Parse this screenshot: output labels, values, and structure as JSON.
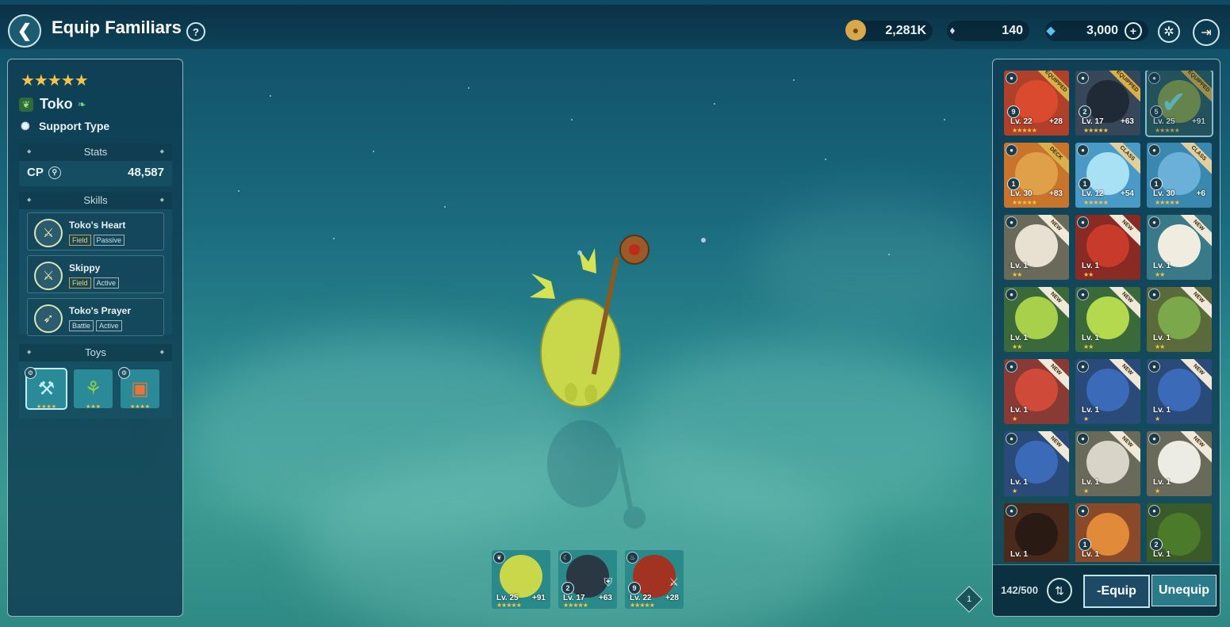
{
  "header": {
    "title": "Equip Familiars",
    "help": "?",
    "currencies": [
      {
        "name": "gold",
        "value": "2,281K",
        "icon": "gold-coin-icon",
        "color": "#d9a84a"
      },
      {
        "name": "crystal",
        "value": "140",
        "icon": "crystal-icon",
        "color": "#b8c8e8"
      },
      {
        "name": "gem",
        "value": "3,000",
        "icon": "diamond-icon",
        "color": "#5fc0f0"
      }
    ]
  },
  "familiar": {
    "stars": "★★★★★",
    "name": "Toko",
    "type": "Support Type",
    "stats_title": "Stats",
    "cp_label": "CP",
    "cp_value": "48,587",
    "skills_title": "Skills",
    "skills": [
      {
        "name": "Toko's Heart",
        "tag1": "Field",
        "tag2": "Passive"
      },
      {
        "name": "Skippy",
        "tag1": "Field",
        "tag2": "Active"
      },
      {
        "name": "Toko's Prayer",
        "tag1": "Battle",
        "tag2": "Active"
      }
    ],
    "toys_title": "Toys",
    "toys": [
      {
        "stars": "★★★★"
      },
      {
        "stars": "★★★"
      },
      {
        "stars": "★★★★"
      }
    ]
  },
  "team": [
    {
      "slot": "",
      "lv": "Lv. 25",
      "plus": "+91",
      "stars": "★★★★★",
      "color": "#b8c838"
    },
    {
      "slot": "2",
      "lv": "Lv. 17",
      "plus": "+63",
      "stars": "★★★★★",
      "color": "#2a3844"
    },
    {
      "slot": "9",
      "lv": "Lv. 22",
      "plus": "+28",
      "stars": "★★★★★",
      "color": "#a23222"
    }
  ],
  "page_number": "1",
  "inventory": {
    "cards": [
      {
        "ribbon": "EQUIPPED",
        "slot": "9",
        "lv": "Lv. 22",
        "plus": "+28",
        "stars": "★★★★★",
        "color": "#b0402a",
        "face": "#d94a2e"
      },
      {
        "ribbon": "EQUIPPED",
        "slot": "2",
        "lv": "Lv. 17",
        "plus": "+63",
        "stars": "★★★★★",
        "color": "#37475a",
        "face": "#1f2a36"
      },
      {
        "ribbon": "EQUIPPED",
        "slot": "5",
        "lv": "Lv. 25",
        "plus": "+91",
        "stars": "★★★★★",
        "color": "#2c5a60",
        "face": "#8aa048"
      },
      {
        "ribbon": "DECK",
        "slot": "1",
        "lv": "Lv. 30",
        "plus": "+83",
        "stars": "★★★★★",
        "color": "#c9742c",
        "face": "#e0a04a"
      },
      {
        "ribbon": "CLASS",
        "slot": "1",
        "lv": "Lv. 12",
        "plus": "+54",
        "stars": "★★★★★",
        "color": "#4a9ac8",
        "face": "#a8e0f4"
      },
      {
        "ribbon": "CLASS",
        "slot": "1",
        "lv": "Lv. 30",
        "plus": "+6",
        "stars": "★★★★★",
        "color": "#3a88b0",
        "face": "#6ab0d8"
      },
      {
        "ribbon": "NEW",
        "slot": "",
        "lv": "Lv. 1",
        "plus": "",
        "stars": "★★",
        "color": "#6a6a5a",
        "face": "#e8e0d0"
      },
      {
        "ribbon": "NEW",
        "slot": "",
        "lv": "Lv. 1",
        "plus": "",
        "stars": "★★",
        "color": "#8a2a24",
        "face": "#c83a2a"
      },
      {
        "ribbon": "NEW",
        "slot": "",
        "lv": "Lv. 1",
        "plus": "",
        "stars": "★★",
        "color": "#3a7a88",
        "face": "#f0ece0"
      },
      {
        "ribbon": "NEW",
        "slot": "",
        "lv": "Lv. 1",
        "plus": "",
        "stars": "★★",
        "color": "#3a6a3a",
        "face": "#a8d04a"
      },
      {
        "ribbon": "NEW",
        "slot": "",
        "lv": "Lv. 1",
        "plus": "",
        "stars": "★★",
        "color": "#3a6a3a",
        "face": "#b4d84e"
      },
      {
        "ribbon": "NEW",
        "slot": "",
        "lv": "Lv. 1",
        "plus": "",
        "stars": "★★",
        "color": "#5a6a3a",
        "face": "#7aa84a"
      },
      {
        "ribbon": "NEW",
        "slot": "",
        "lv": "Lv. 1",
        "plus": "",
        "stars": "★",
        "color": "#8a3a34",
        "face": "#d04a3a"
      },
      {
        "ribbon": "NEW",
        "slot": "",
        "lv": "Lv. 1",
        "plus": "",
        "stars": "★",
        "color": "#2a4a7a",
        "face": "#3a6ab8"
      },
      {
        "ribbon": "NEW",
        "slot": "",
        "lv": "Lv. 1",
        "plus": "",
        "stars": "★",
        "color": "#2a4a7a",
        "face": "#3a6ab8"
      },
      {
        "ribbon": "NEW",
        "slot": "",
        "lv": "Lv. 1",
        "plus": "",
        "stars": "★",
        "color": "#2a4a7a",
        "face": "#3a6ab8"
      },
      {
        "ribbon": "NEW",
        "slot": "",
        "lv": "Lv. 1",
        "plus": "",
        "stars": "★",
        "color": "#6a6a5a",
        "face": "#d8d4c8"
      },
      {
        "ribbon": "NEW",
        "slot": "",
        "lv": "Lv. 1",
        "plus": "",
        "stars": "★",
        "color": "#6a6a5a",
        "face": "#ecece4"
      },
      {
        "ribbon": "",
        "slot": "",
        "lv": "Lv. 1",
        "plus": "",
        "stars": "",
        "color": "#4a2a1a",
        "face": "#2a1a14"
      },
      {
        "ribbon": "",
        "slot": "1",
        "lv": "Lv. 1",
        "plus": "",
        "stars": "",
        "color": "#8a4a2a",
        "face": "#e08a3a"
      },
      {
        "ribbon": "",
        "slot": "2",
        "lv": "Lv. 1",
        "plus": "",
        "stars": "",
        "color": "#3a5a2a",
        "face": "#4a7a2a"
      }
    ],
    "count": "142/500",
    "equip_label": "-Equip",
    "unequip_label": "Unequip"
  }
}
